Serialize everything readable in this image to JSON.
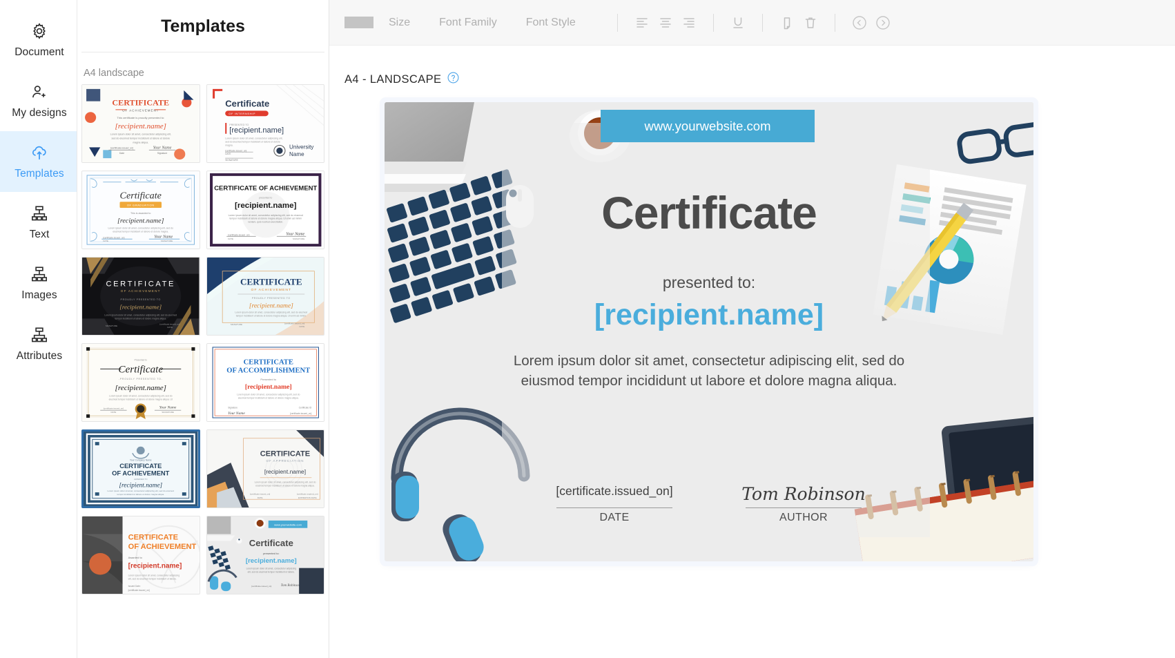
{
  "sidebar": {
    "items": [
      {
        "label": "Document",
        "icon": "gear-icon",
        "active": false
      },
      {
        "label": "My designs",
        "icon": "user-add-icon",
        "active": false
      },
      {
        "label": "Templates",
        "icon": "cloud-upload-icon",
        "active": true
      },
      {
        "label": "Text",
        "icon": "sitemap-icon",
        "active": false
      },
      {
        "label": "Images",
        "icon": "sitemap-icon",
        "active": false
      },
      {
        "label": "Attributes",
        "icon": "sitemap-icon",
        "active": false
      }
    ],
    "active_accent": "#3d9bf5",
    "active_background": "#e3f2fe"
  },
  "templates_panel": {
    "title": "Templates",
    "group_label": "A4 landscape",
    "selected_index": 6,
    "items": [
      {
        "name": "CERTIFICATE",
        "subtitle": "OF ACHIEVEMENT",
        "recipient": "[recipient.name]",
        "style": "memphis-orange"
      },
      {
        "name": "Certificate",
        "subtitle": "OF INTERNSHIP",
        "recipient": "[recipient.name]",
        "style": "red-minimal"
      },
      {
        "name": "Certificate",
        "subtitle": "OF GRADUATION",
        "recipient": "[recipient.name]",
        "style": "ornate-blue"
      },
      {
        "name": "CERTIFICATE OF ACHIEVEMENT",
        "subtitle": "",
        "recipient": "[recipient.name]",
        "style": "purple-frame"
      },
      {
        "name": "CERTIFICATE",
        "subtitle": "OF ACHIEVEMENT",
        "recipient": "[recipient.name]",
        "style": "black-gold"
      },
      {
        "name": "CERTIFICATE",
        "subtitle": "OF ACHIEVEMENT",
        "recipient": "[recipient.name]",
        "style": "navy-wave"
      },
      {
        "name": "Certificate",
        "subtitle": "PROUDLY PRESENTED TO",
        "recipient": "[recipient.name]",
        "style": "seal-classic"
      },
      {
        "name": "CERTIFICATE OF ACCOMPLISHMENT",
        "subtitle": "Presented to",
        "recipient": "[recipient.name]",
        "style": "blue-red-border"
      },
      {
        "name": "CERTIFICATE OF ACHIEVEMENT",
        "subtitle": "AWARDED TO",
        "recipient": "[recipient.name]",
        "style": "navy-double"
      },
      {
        "name": "CERTIFICATE",
        "subtitle": "OF APPRECIATION",
        "recipient": "[recipient.name]",
        "style": "desk-corner"
      },
      {
        "name": "CERTIFICATE OF ACHIEVEMENT",
        "subtitle": "Awarded to",
        "recipient": "[recipient.name]",
        "style": "basketball"
      },
      {
        "name": "Certificate",
        "subtitle": "presented to",
        "recipient": "[recipient.name]",
        "style": "desk-blue"
      }
    ]
  },
  "toolbar": {
    "color_swatch": "#c4c4c4",
    "size_label": "Size",
    "font_family_label": "Font Family",
    "font_style_label": "Font Style",
    "align_left": "align-left",
    "align_center": "align-center",
    "align_right": "align-right",
    "underline": "U",
    "duplicate": "duplicate",
    "delete": "delete",
    "send_backward": "send-backward",
    "bring_forward": "bring-forward",
    "disabled": true
  },
  "canvas": {
    "format_label": "A4 - LANDSCAPE",
    "help_tooltip": "?",
    "accent_blue": "#47aad4",
    "page_background": "#ececec",
    "certificate": {
      "website": "www.yourwebsite.com",
      "title": "Certificate",
      "presented_to": "presented to:",
      "recipient": "[recipient.name]",
      "body": "Lorem ipsum dolor sit amet, consectetur adipiscing elit, sed do eiusmod tempor incididunt ut labore et dolore magna aliqua.",
      "date_value": "[certificate.issued_on]",
      "date_label": "DATE",
      "author_value": "Tom Robinson",
      "author_label": "AUTHOR"
    }
  }
}
